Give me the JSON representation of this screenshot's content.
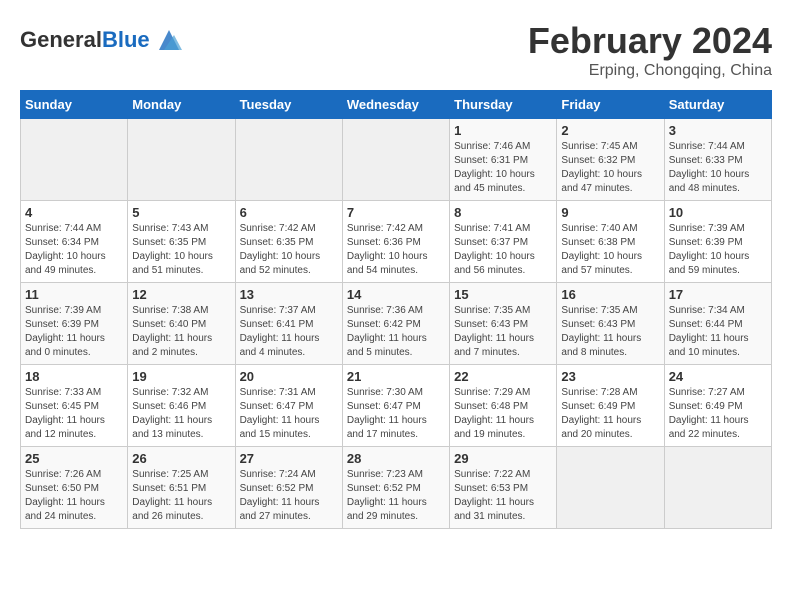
{
  "logo": {
    "general": "General",
    "blue": "Blue"
  },
  "title": {
    "month_year": "February 2024",
    "location": "Erping, Chongqing, China"
  },
  "headers": [
    "Sunday",
    "Monday",
    "Tuesday",
    "Wednesday",
    "Thursday",
    "Friday",
    "Saturday"
  ],
  "weeks": [
    [
      {
        "day": "",
        "sunrise": "",
        "sunset": "",
        "daylight": ""
      },
      {
        "day": "",
        "sunrise": "",
        "sunset": "",
        "daylight": ""
      },
      {
        "day": "",
        "sunrise": "",
        "sunset": "",
        "daylight": ""
      },
      {
        "day": "",
        "sunrise": "",
        "sunset": "",
        "daylight": ""
      },
      {
        "day": "1",
        "sunrise": "Sunrise: 7:46 AM",
        "sunset": "Sunset: 6:31 PM",
        "daylight": "Daylight: 10 hours and 45 minutes."
      },
      {
        "day": "2",
        "sunrise": "Sunrise: 7:45 AM",
        "sunset": "Sunset: 6:32 PM",
        "daylight": "Daylight: 10 hours and 47 minutes."
      },
      {
        "day": "3",
        "sunrise": "Sunrise: 7:44 AM",
        "sunset": "Sunset: 6:33 PM",
        "daylight": "Daylight: 10 hours and 48 minutes."
      }
    ],
    [
      {
        "day": "4",
        "sunrise": "Sunrise: 7:44 AM",
        "sunset": "Sunset: 6:34 PM",
        "daylight": "Daylight: 10 hours and 49 minutes."
      },
      {
        "day": "5",
        "sunrise": "Sunrise: 7:43 AM",
        "sunset": "Sunset: 6:35 PM",
        "daylight": "Daylight: 10 hours and 51 minutes."
      },
      {
        "day": "6",
        "sunrise": "Sunrise: 7:42 AM",
        "sunset": "Sunset: 6:35 PM",
        "daylight": "Daylight: 10 hours and 52 minutes."
      },
      {
        "day": "7",
        "sunrise": "Sunrise: 7:42 AM",
        "sunset": "Sunset: 6:36 PM",
        "daylight": "Daylight: 10 hours and 54 minutes."
      },
      {
        "day": "8",
        "sunrise": "Sunrise: 7:41 AM",
        "sunset": "Sunset: 6:37 PM",
        "daylight": "Daylight: 10 hours and 56 minutes."
      },
      {
        "day": "9",
        "sunrise": "Sunrise: 7:40 AM",
        "sunset": "Sunset: 6:38 PM",
        "daylight": "Daylight: 10 hours and 57 minutes."
      },
      {
        "day": "10",
        "sunrise": "Sunrise: 7:39 AM",
        "sunset": "Sunset: 6:39 PM",
        "daylight": "Daylight: 10 hours and 59 minutes."
      }
    ],
    [
      {
        "day": "11",
        "sunrise": "Sunrise: 7:39 AM",
        "sunset": "Sunset: 6:39 PM",
        "daylight": "Daylight: 11 hours and 0 minutes."
      },
      {
        "day": "12",
        "sunrise": "Sunrise: 7:38 AM",
        "sunset": "Sunset: 6:40 PM",
        "daylight": "Daylight: 11 hours and 2 minutes."
      },
      {
        "day": "13",
        "sunrise": "Sunrise: 7:37 AM",
        "sunset": "Sunset: 6:41 PM",
        "daylight": "Daylight: 11 hours and 4 minutes."
      },
      {
        "day": "14",
        "sunrise": "Sunrise: 7:36 AM",
        "sunset": "Sunset: 6:42 PM",
        "daylight": "Daylight: 11 hours and 5 minutes."
      },
      {
        "day": "15",
        "sunrise": "Sunrise: 7:35 AM",
        "sunset": "Sunset: 6:43 PM",
        "daylight": "Daylight: 11 hours and 7 minutes."
      },
      {
        "day": "16",
        "sunrise": "Sunrise: 7:35 AM",
        "sunset": "Sunset: 6:43 PM",
        "daylight": "Daylight: 11 hours and 8 minutes."
      },
      {
        "day": "17",
        "sunrise": "Sunrise: 7:34 AM",
        "sunset": "Sunset: 6:44 PM",
        "daylight": "Daylight: 11 hours and 10 minutes."
      }
    ],
    [
      {
        "day": "18",
        "sunrise": "Sunrise: 7:33 AM",
        "sunset": "Sunset: 6:45 PM",
        "daylight": "Daylight: 11 hours and 12 minutes."
      },
      {
        "day": "19",
        "sunrise": "Sunrise: 7:32 AM",
        "sunset": "Sunset: 6:46 PM",
        "daylight": "Daylight: 11 hours and 13 minutes."
      },
      {
        "day": "20",
        "sunrise": "Sunrise: 7:31 AM",
        "sunset": "Sunset: 6:47 PM",
        "daylight": "Daylight: 11 hours and 15 minutes."
      },
      {
        "day": "21",
        "sunrise": "Sunrise: 7:30 AM",
        "sunset": "Sunset: 6:47 PM",
        "daylight": "Daylight: 11 hours and 17 minutes."
      },
      {
        "day": "22",
        "sunrise": "Sunrise: 7:29 AM",
        "sunset": "Sunset: 6:48 PM",
        "daylight": "Daylight: 11 hours and 19 minutes."
      },
      {
        "day": "23",
        "sunrise": "Sunrise: 7:28 AM",
        "sunset": "Sunset: 6:49 PM",
        "daylight": "Daylight: 11 hours and 20 minutes."
      },
      {
        "day": "24",
        "sunrise": "Sunrise: 7:27 AM",
        "sunset": "Sunset: 6:49 PM",
        "daylight": "Daylight: 11 hours and 22 minutes."
      }
    ],
    [
      {
        "day": "25",
        "sunrise": "Sunrise: 7:26 AM",
        "sunset": "Sunset: 6:50 PM",
        "daylight": "Daylight: 11 hours and 24 minutes."
      },
      {
        "day": "26",
        "sunrise": "Sunrise: 7:25 AM",
        "sunset": "Sunset: 6:51 PM",
        "daylight": "Daylight: 11 hours and 26 minutes."
      },
      {
        "day": "27",
        "sunrise": "Sunrise: 7:24 AM",
        "sunset": "Sunset: 6:52 PM",
        "daylight": "Daylight: 11 hours and 27 minutes."
      },
      {
        "day": "28",
        "sunrise": "Sunrise: 7:23 AM",
        "sunset": "Sunset: 6:52 PM",
        "daylight": "Daylight: 11 hours and 29 minutes."
      },
      {
        "day": "29",
        "sunrise": "Sunrise: 7:22 AM",
        "sunset": "Sunset: 6:53 PM",
        "daylight": "Daylight: 11 hours and 31 minutes."
      },
      {
        "day": "",
        "sunrise": "",
        "sunset": "",
        "daylight": ""
      },
      {
        "day": "",
        "sunrise": "",
        "sunset": "",
        "daylight": ""
      }
    ]
  ]
}
